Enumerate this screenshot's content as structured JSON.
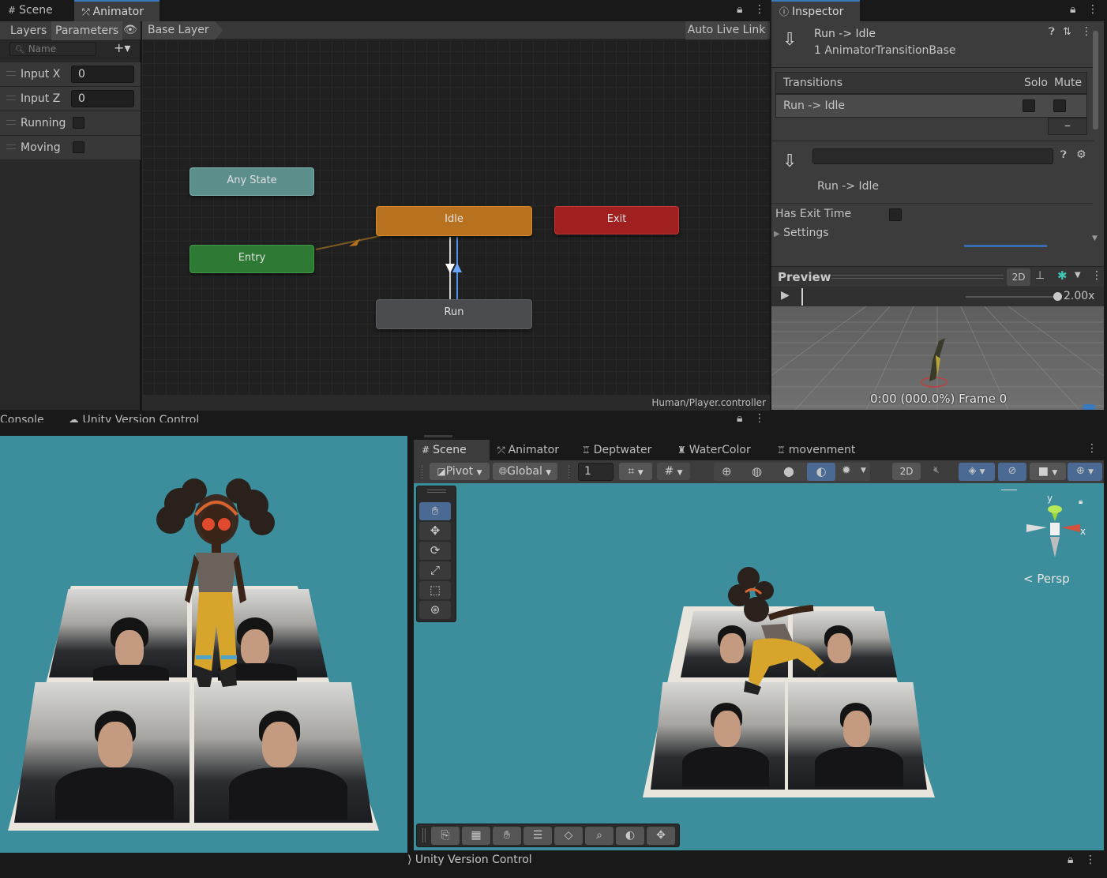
{
  "top_tabs": {
    "scene": "Scene",
    "animator": "Animator"
  },
  "animator": {
    "left_tabs": {
      "layers": "Layers",
      "parameters": "Parameters"
    },
    "search_placeholder": "Name",
    "add": "+▾",
    "parameters": [
      {
        "name": "Input X",
        "type": "float",
        "value": "0"
      },
      {
        "name": "Input  Z",
        "type": "float",
        "value": "0"
      },
      {
        "name": "Running",
        "type": "bool",
        "value": ""
      },
      {
        "name": "Moving",
        "type": "bool",
        "value": ""
      }
    ],
    "breadcrumb": "Base Layer",
    "auto_live_link": "Auto Live Link",
    "states": {
      "any_state": "Any State",
      "entry": "Entry",
      "idle": "Idle",
      "exit": "Exit",
      "run": "Run"
    },
    "state_colors": {
      "any_state": "#5c8e8b",
      "entry": "#2e7a34",
      "idle": "#b8711f",
      "exit": "#a01f1f",
      "run": "#4a4b4e"
    },
    "footer": "Human/Player.controller"
  },
  "inspector": {
    "tab": "Inspector",
    "title": "Run -> Idle",
    "subtitle": "1 AnimatorTransitionBase",
    "transitions_header": "Transitions",
    "solo": "Solo",
    "mute": "Mute",
    "transition_row": "Run -> Idle",
    "minus": "–",
    "transition_name": "Run -> Idle",
    "has_exit_time": "Has Exit Time",
    "settings": "Settings",
    "preview": "Preview",
    "preview_2d": "2D",
    "speed": "2.00x",
    "frame": "0:00 (000.0%) Frame 0"
  },
  "bottom_tabs_partial": {
    "console": "Console",
    "uvc": "Unity Version Control"
  },
  "scene_tabs": {
    "scene": "Scene",
    "animator": "Animator",
    "deptwater": "Deptwater",
    "watercolor": "WaterColor",
    "movenment": "movenment"
  },
  "scene_toolbar": {
    "pivot": "Pivot",
    "global": "Global",
    "grid_value": "1",
    "two_d": "2D"
  },
  "gizmo": {
    "y": "y",
    "x": "x",
    "persp": "Persp"
  },
  "status_bar": {
    "uvc": "Unity Version Control"
  },
  "colors": {
    "accent": "#3a79bb",
    "scene_bg": "#3c8e9c",
    "panel": "#3c3c3c",
    "graph": "#202020"
  }
}
